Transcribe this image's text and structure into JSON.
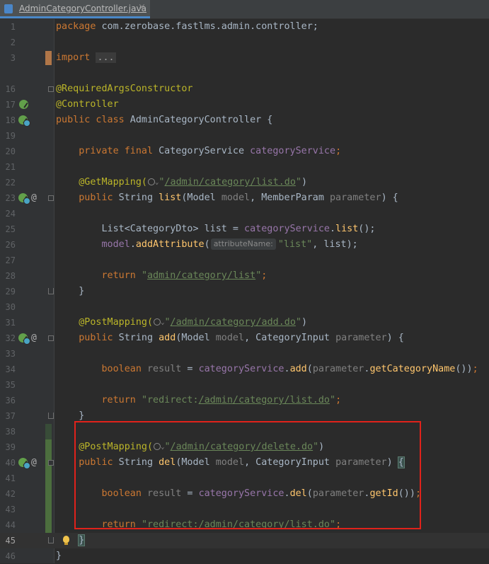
{
  "tab": {
    "title": "AdminCategoryController.java",
    "close_glyph": "×"
  },
  "code": {
    "package_kw": "package",
    "package_name": " com.zerobase.fastlms.admin.controller;",
    "import_kw": "import",
    "import_folded": "...",
    "ann_required": "@RequiredArgsConstructor",
    "ann_controller": "@Controller",
    "class_decl": "public class",
    "class_name": " AdminCategoryController {",
    "field_kw": "private final",
    "field_type": " CategoryService ",
    "field_name": "categoryService",
    "semi": ";",
    "get_mapping": "@GetMapping(",
    "get_path": "/admin/category/list.do",
    "list_sig_kw": "public",
    "list_sig_type": " String ",
    "list_name": "list",
    "list_params_a": "(Model ",
    "list_param_model": "model",
    "list_params_b": ", MemberParam ",
    "list_param_parameter": "parameter",
    "list_params_end": ") {",
    "list_line1_a": "List<CategoryDto> list = ",
    "list_line1_b": "categoryService",
    "list_line1_c": ".",
    "list_line1_d": "list",
    "list_line1_e": "();",
    "list_line2_a": "model",
    "list_line2_b": ".",
    "list_line2_c": "addAttribute",
    "list_line2_hint": "attributeName:",
    "list_line2_str": "\"list\"",
    "list_line2_end": ", list);",
    "return_kw": "return",
    "list_return_path": "admin/category/list",
    "close_brace": "}",
    "post_mapping": "@PostMapping(",
    "add_path": "/admin/category/add.do",
    "add_name": "add",
    "category_input": ", CategoryInput ",
    "bool_kw": "boolean",
    "result_var": " result",
    "eq": " = ",
    "add_call": "add",
    "get_category_name": "getCategoryName",
    "redirect_prefix": "redirect:",
    "redirect_path": "/admin/category/list.do",
    "delete_path": "/admin/category/delete.do",
    "del_name": "del",
    "del_call": "del",
    "get_id": "getId"
  },
  "line_numbers": [
    "1",
    "2",
    "3",
    "16",
    "17",
    "18",
    "19",
    "20",
    "21",
    "22",
    "23",
    "24",
    "25",
    "26",
    "27",
    "28",
    "29",
    "30",
    "31",
    "32",
    "33",
    "34",
    "35",
    "36",
    "37",
    "38",
    "39",
    "40",
    "41",
    "42",
    "43",
    "44",
    "45",
    "46"
  ],
  "colors": {
    "background": "#2b2b2b",
    "keyword": "#cc7832",
    "annotation": "#bbb529",
    "string": "#6a8759",
    "field": "#9876aa",
    "highlight_box": "#e0221b"
  },
  "icons": [
    "bean-icon",
    "spring-web-icon",
    "at-sign-icon",
    "fold-icon",
    "lightbulb-icon",
    "java-file-icon",
    "globe-icon"
  ]
}
